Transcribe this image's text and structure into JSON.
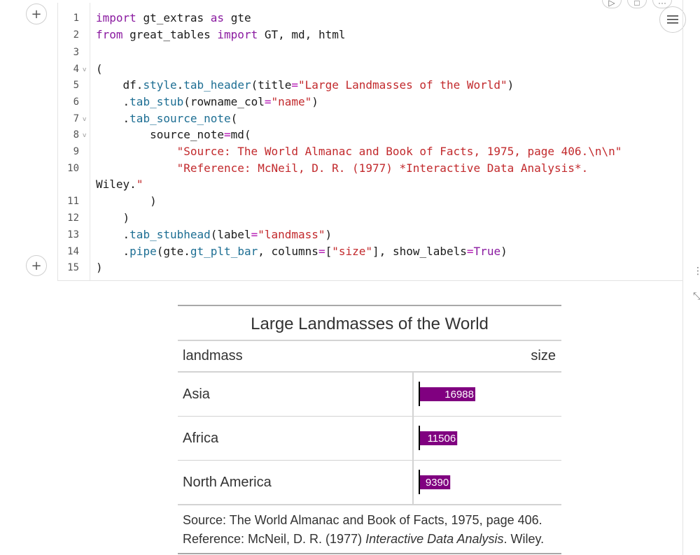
{
  "notebook": {
    "code_lines": [
      {
        "no": "1",
        "fold": false
      },
      {
        "no": "2",
        "fold": false
      },
      {
        "no": "3",
        "fold": false
      },
      {
        "no": "4",
        "fold": true
      },
      {
        "no": "5",
        "fold": false
      },
      {
        "no": "6",
        "fold": false
      },
      {
        "no": "7",
        "fold": true
      },
      {
        "no": "8",
        "fold": true
      },
      {
        "no": "9",
        "fold": false
      },
      {
        "no": "10",
        "fold": false
      },
      {
        "no": "11",
        "fold": false
      },
      {
        "no": "12",
        "fold": false
      },
      {
        "no": "13",
        "fold": false
      },
      {
        "no": "14",
        "fold": false
      },
      {
        "no": "15",
        "fold": false
      }
    ],
    "code_text": [
      "import gt_extras as gte",
      "from great_tables import GT, md, html",
      "",
      "(",
      "    df.style.tab_header(title=\"Large Landmasses of the World\")",
      "    .tab_stub(rowname_col=\"name\")",
      "    .tab_source_note(",
      "        source_note=md(",
      "            \"Source: The World Almanac and Book of Facts, 1975, page 406.\\n\\n\"",
      "            \"Reference: McNeil, D. R. (1977) *Interactive Data Analysis*.",
      "Wiley.\"",
      "        )",
      "    )",
      "    .tab_stubhead(label=\"landmass\")",
      "    .pipe(gte.gt_plt_bar, columns=[\"size\"], show_labels=True)",
      ")"
    ]
  },
  "table": {
    "title": "Large Landmasses of the World",
    "stubhead": "landmass",
    "size_header": "size",
    "rows": [
      {
        "name": "Asia",
        "size": "16988"
      },
      {
        "name": "Africa",
        "size": "11506"
      },
      {
        "name": "North America",
        "size": "9390"
      }
    ],
    "source_line1": "Source: The World Almanac and Book of Facts, 1975, page 406.",
    "source_ref_prefix": "Reference: McNeil, D. R. (1977) ",
    "source_ref_italic": "Interactive Data Analysis",
    "source_ref_suffix": ". Wiley."
  },
  "chart_data": {
    "type": "bar",
    "categories": [
      "Asia",
      "Africa",
      "North America"
    ],
    "values": [
      16988,
      11506,
      9390
    ],
    "bar_color": "#800080",
    "label_color": "#ffffff"
  },
  "icons": {
    "add_cell": "+",
    "menu": "≡",
    "run": "▷",
    "stop": "□",
    "more": "···",
    "delete": "🗑",
    "expand": "⤡"
  }
}
